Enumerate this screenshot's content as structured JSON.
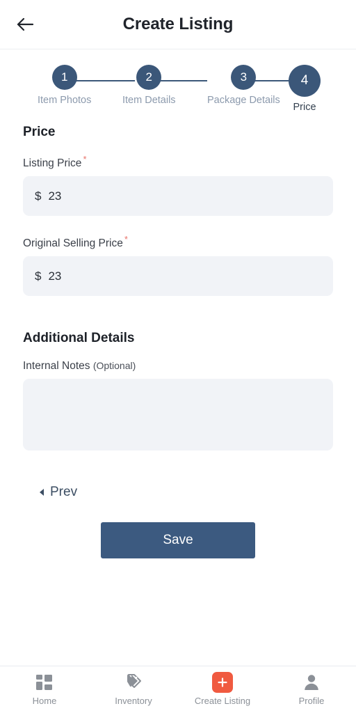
{
  "header": {
    "title": "Create Listing",
    "back_icon": "arrow-left-icon"
  },
  "stepper": {
    "steps": [
      {
        "number": "1",
        "label": "Item Photos",
        "active": false
      },
      {
        "number": "2",
        "label": "Item Details",
        "active": false
      },
      {
        "number": "3",
        "label": "Package Details",
        "active": false
      },
      {
        "number": "4",
        "label": "Price",
        "active": true
      }
    ]
  },
  "price_section": {
    "title": "Price",
    "listing_price": {
      "label": "Listing Price",
      "required_marker": "*",
      "currency": "$",
      "value": "23"
    },
    "original_selling_price": {
      "label": "Original Selling Price",
      "required_marker": "*",
      "currency": "$",
      "value": "23"
    }
  },
  "additional_section": {
    "title": "Additional Details",
    "internal_notes": {
      "label": "Internal Notes",
      "optional_suffix": "(Optional)",
      "value": "",
      "placeholder": ""
    }
  },
  "actions": {
    "prev_label": "Prev",
    "prev_icon": "caret-left-icon",
    "save_label": "Save"
  },
  "bottom_nav": {
    "items": [
      {
        "label": "Home",
        "icon": "dashboard-grid-icon",
        "active": false
      },
      {
        "label": "Inventory",
        "icon": "tags-icon",
        "active": false
      },
      {
        "label": "Create Listing",
        "icon": "plus-square-icon",
        "active": true
      },
      {
        "label": "Profile",
        "icon": "person-icon",
        "active": false
      }
    ]
  },
  "colors": {
    "accent_blue": "#3b5779",
    "save_button": "#3c5a80",
    "create_listing_red": "#f05a40",
    "input_background": "#f1f3f7",
    "required_red": "#e8736a",
    "inactive_step_label": "#8c9aad"
  }
}
